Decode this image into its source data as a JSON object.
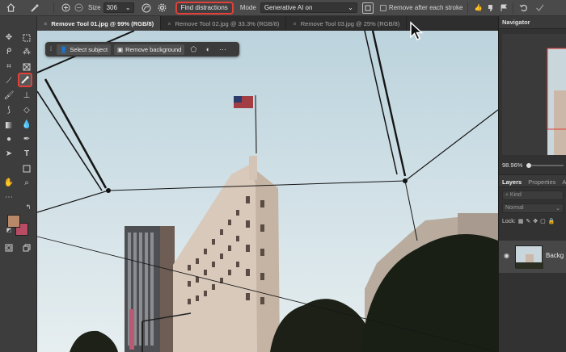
{
  "options_bar": {
    "size_label": "Size",
    "size_value": "306",
    "find_distractions_label": "Find distractions",
    "mode_label": "Mode",
    "mode_value": "Generative AI on",
    "remove_after_stroke_label": "Remove after each stroke"
  },
  "tabs": [
    {
      "label": "Remove Tool 01.jpg @ 99% (RGB/8)",
      "active": true
    },
    {
      "label": "Remove Tool 02.jpg @ 33.3% (RGB/8)",
      "active": false
    },
    {
      "label": "Remove Tool 03.jpg @ 25% (RGB/8)",
      "active": false
    }
  ],
  "task_bar": {
    "select_subject_label": "Select subject",
    "remove_background_label": "Remove background"
  },
  "navigator": {
    "title": "Navigator",
    "zoom": "98.96%"
  },
  "layers_panel": {
    "tabs": [
      "Layers",
      "Properties",
      "A"
    ],
    "kind_placeholder": "Kind",
    "blend_mode": "Normal",
    "lock_label": "Lock:",
    "layer_name": "Backg"
  },
  "colors": {
    "foreground": "#b88968",
    "background": "#b94b63",
    "accent_highlight": "#e2403a"
  }
}
